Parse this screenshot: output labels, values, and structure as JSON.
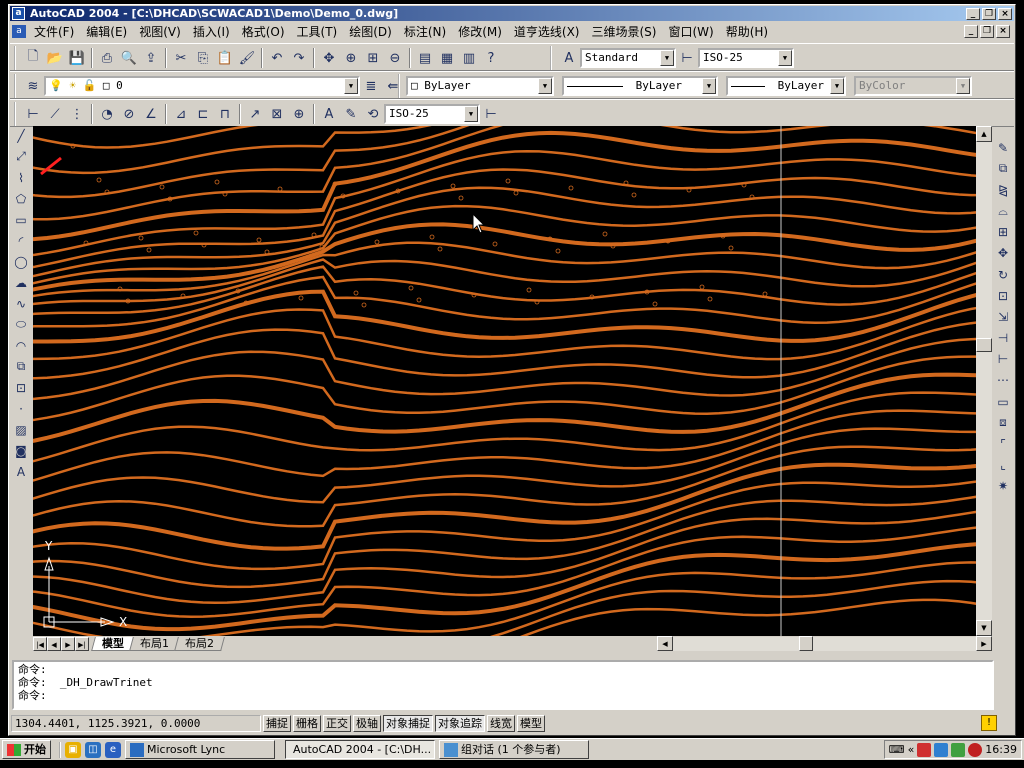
{
  "window": {
    "title": "AutoCAD 2004 - [C:\\DHCAD\\SCWACAD1\\Demo\\Demo_0.dwg]"
  },
  "menubar": {
    "items": [
      "文件(F)",
      "编辑(E)",
      "视图(V)",
      "插入(I)",
      "格式(O)",
      "工具(T)",
      "绘图(D)",
      "标注(N)",
      "修改(M)",
      "道亨选线(X)",
      "三维场景(S)",
      "窗口(W)",
      "帮助(H)"
    ]
  },
  "toolbar": {
    "text_style": "Standard",
    "dim_style": "ISO-25",
    "dim_style_2": "ISO-25",
    "layer": "0",
    "color": "ByLayer",
    "linetype": "ByLayer",
    "lineweight": "ByLayer",
    "plotstyle": "ByColor"
  },
  "layout_tabs": [
    "模型",
    "布局1",
    "布局2"
  ],
  "command": {
    "lines": [
      "命令:",
      "命令:  _DH_DrawTrinet",
      "命令:"
    ]
  },
  "status": {
    "coords": "1304.4401, 1125.3921, 0.0000",
    "toggles": [
      "捕捉",
      "栅格",
      "正交",
      "极轴",
      "对象捕捉",
      "对象追踪",
      "线宽",
      "模型"
    ]
  },
  "taskbar": {
    "start": "开始",
    "items": [
      "Microsoft Lync",
      "AutoCAD 2004 - [C:\\DH...",
      "组对话 (1 个参与者)"
    ],
    "clock": "16:39"
  },
  "colors": {
    "contour": "#d2691e",
    "canvas": "#000000",
    "titlebar": "#0a246a"
  }
}
